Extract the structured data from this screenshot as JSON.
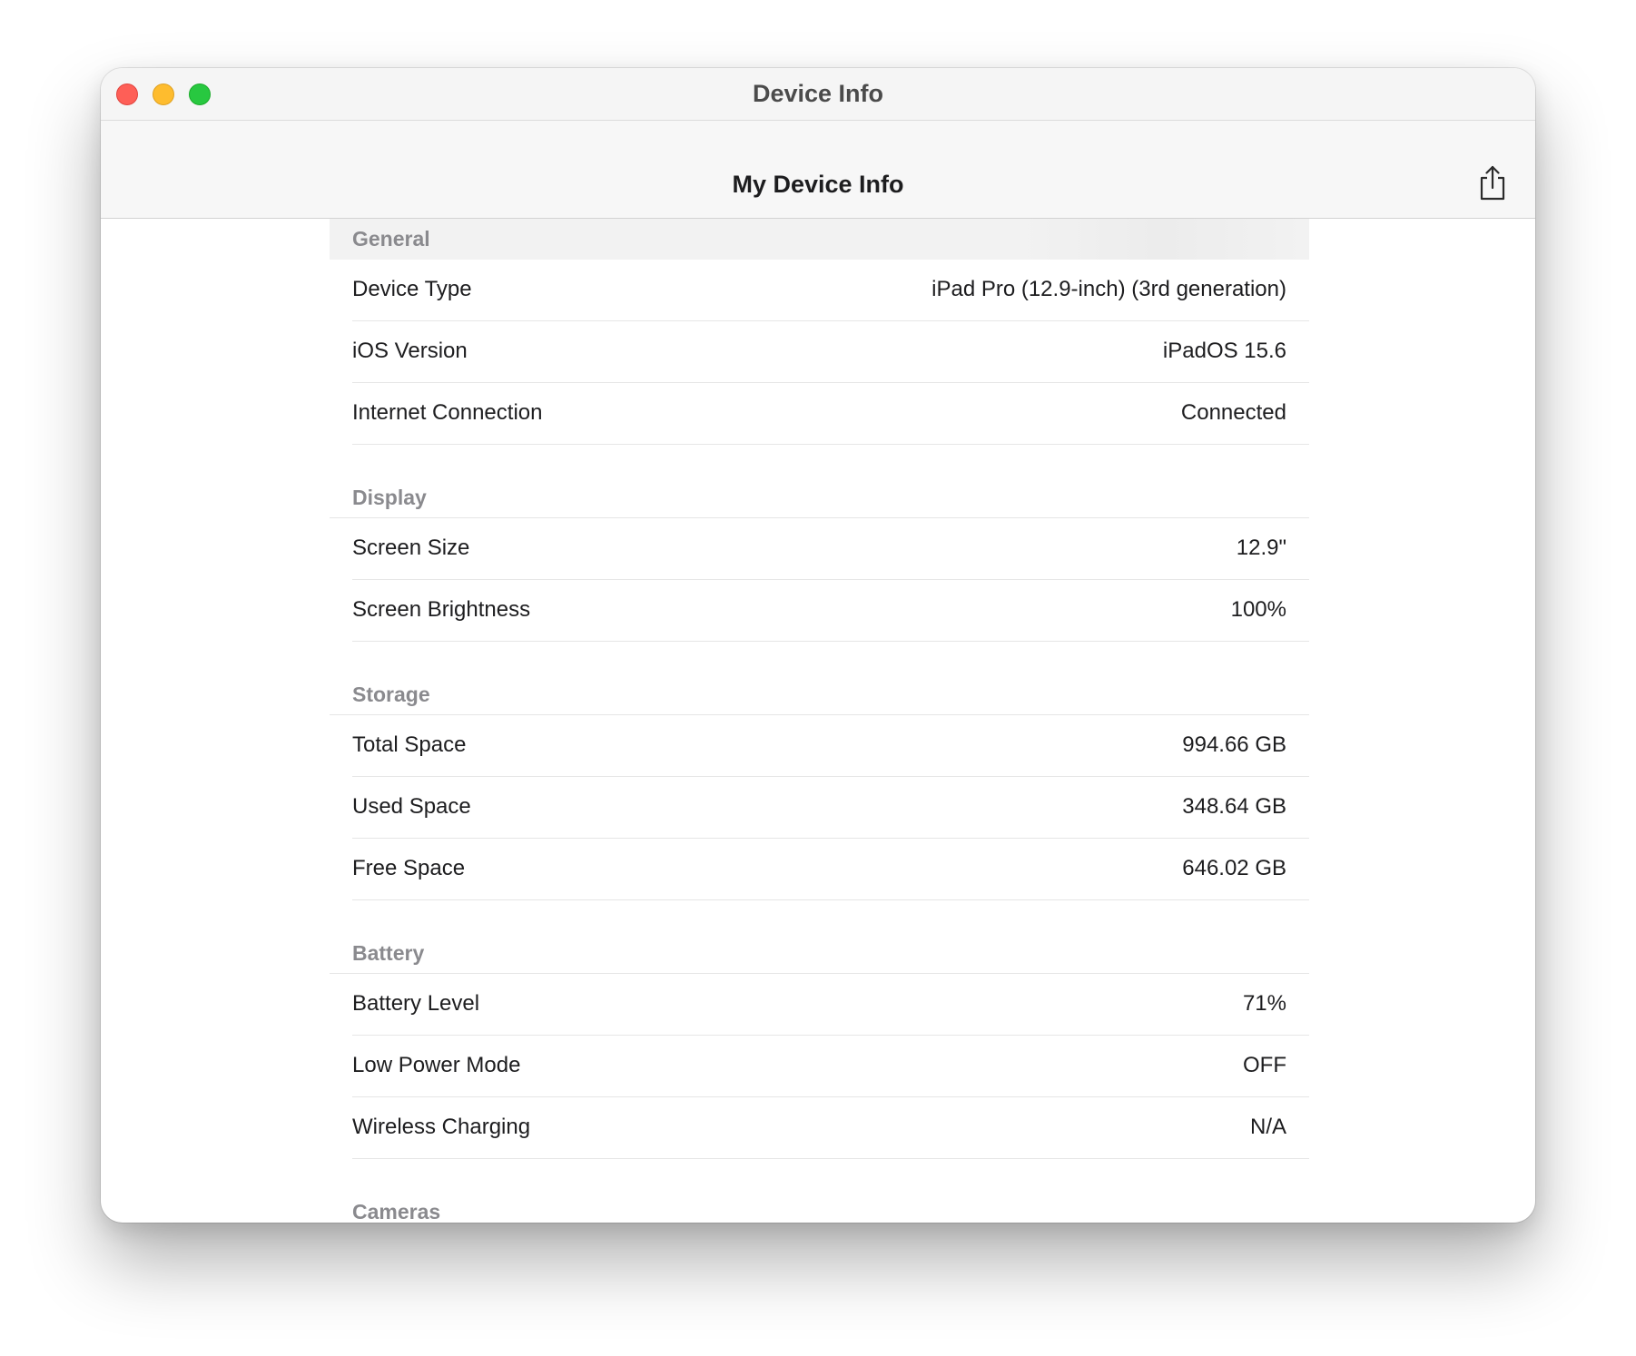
{
  "window": {
    "title": "Device Info"
  },
  "navbar": {
    "title": "My Device Info",
    "share_icon": "share-icon"
  },
  "sections": [
    {
      "header": "General",
      "rows": [
        {
          "label": "Device Type",
          "value": "iPad Pro (12.9-inch) (3rd generation)"
        },
        {
          "label": "iOS Version",
          "value": "iPadOS 15.6"
        },
        {
          "label": "Internet Connection",
          "value": "Connected"
        }
      ]
    },
    {
      "header": "Display",
      "rows": [
        {
          "label": "Screen Size",
          "value": "12.9\""
        },
        {
          "label": "Screen Brightness",
          "value": "100%"
        }
      ]
    },
    {
      "header": "Storage",
      "rows": [
        {
          "label": "Total Space",
          "value": "994.66 GB"
        },
        {
          "label": "Used Space",
          "value": "348.64 GB"
        },
        {
          "label": "Free Space",
          "value": "646.02 GB"
        }
      ]
    },
    {
      "header": "Battery",
      "rows": [
        {
          "label": "Battery Level",
          "value": "71%"
        },
        {
          "label": "Low Power Mode",
          "value": "OFF"
        },
        {
          "label": "Wireless Charging",
          "value": "N/A"
        }
      ]
    },
    {
      "header": "Cameras",
      "rows": []
    }
  ],
  "colors": {
    "close": "#fe5f57",
    "minimize": "#febc2e",
    "maximize": "#28c840",
    "section_header_text": "#8a8a8e",
    "separator": "#e6e6e6"
  }
}
